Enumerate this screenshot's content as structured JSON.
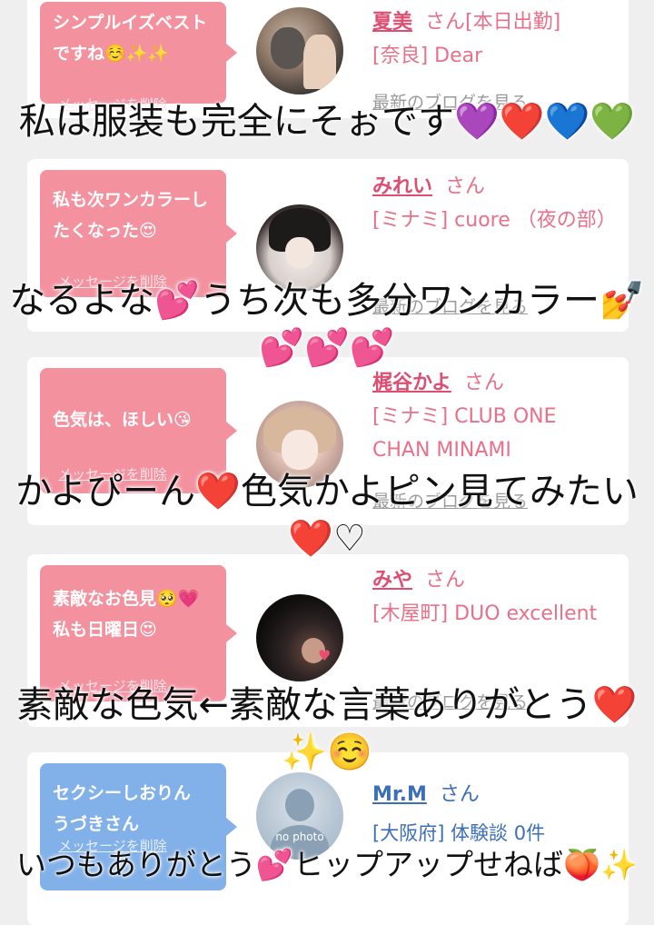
{
  "cards": [
    {
      "bubble": "シンプルイズベストですね☺️✨✨",
      "delete_label": "メッセージを削除",
      "name": "夏美",
      "san": "さん",
      "badge": "[本日出勤]",
      "shop": "[奈良] Dear",
      "blog": "最新のブログを見る",
      "colors": {
        "bubble": "#f3919f",
        "name": "#de4e72"
      }
    },
    {
      "bubble": "私も次ワンカラーしたくなった😍",
      "delete_label": "メッセージを削除",
      "name": "みれい",
      "san": "さん",
      "shop": "[ミナミ] cuore （夜の部）",
      "blog": "最新のブログを見る"
    },
    {
      "bubble": "色気は、ほしい😘",
      "delete_label": "メッセージを削除",
      "name": "梶谷かよ",
      "san": "さん",
      "shop": "[ミナミ] CLUB ONE CHAN MINAMI",
      "blog": "最新のブログを見る"
    },
    {
      "bubble": "素敵なお色見🥺💗私も日曜日😍",
      "delete_label": "メッセージを削除",
      "name": "みや",
      "san": "さん",
      "shop": "[木屋町] DUO excellent",
      "blog": "最新のブログを見る"
    },
    {
      "bubble": "セクシーしおりん　うづきさん",
      "delete_label": "メッセージを削除",
      "name": "Mr.M",
      "san": "さん",
      "shop": "[大阪府] 体験談 0件",
      "avatar_text": "no photo",
      "colors": {
        "bubble": "#82b0e8",
        "name": "#3c6fb8"
      }
    }
  ],
  "overlays": [
    "私は服装も完全にそぉです💜❤️💙💚",
    "なるよな💕うち次も多分ワンカラー💅💕💕💕",
    "かよぴーん❤️色気かよピン見てみたい❤️♡",
    "素敵な色気←素敵な言葉ありがとう❤️✨☺️",
    "いつもありがとう💕ヒップアップせねば🍑✨"
  ]
}
